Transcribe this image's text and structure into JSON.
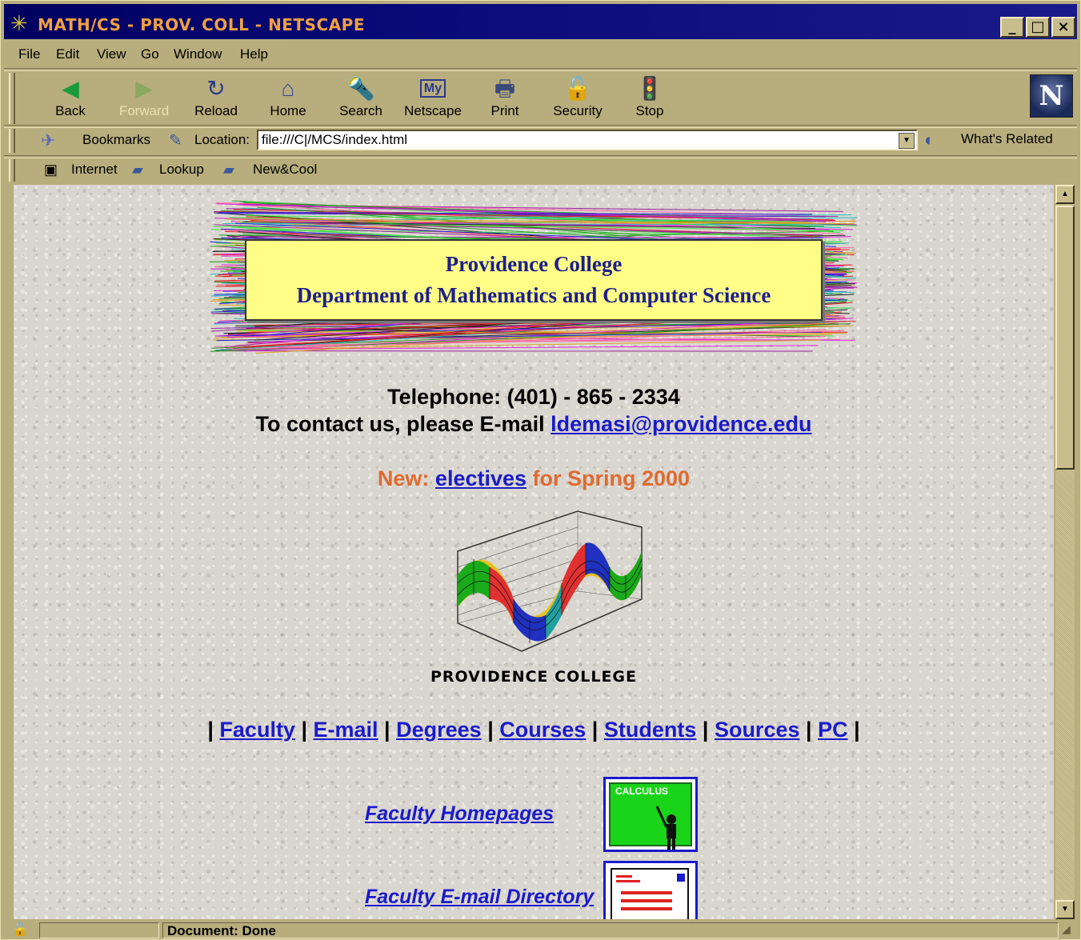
{
  "window": {
    "title": "MATH/CS - PROV. COLL - NETSCAPE",
    "minimize": "_",
    "maximize": "□",
    "close": "×"
  },
  "menu": [
    "File",
    "Edit",
    "View",
    "Go",
    "Window",
    "Help"
  ],
  "nav_toolbar": {
    "back": "Back",
    "forward": "Forward",
    "reload": "Reload",
    "home": "Home",
    "search": "Search",
    "netscape": "Netscape",
    "print": "Print",
    "security": "Security",
    "stop": "Stop",
    "logo": "N"
  },
  "location_bar": {
    "bookmarks": "Bookmarks",
    "location_label": "Location:",
    "url": "file:///C|/MCS/index.html",
    "whats_related": "What's Related"
  },
  "personal_toolbar": [
    "Internet",
    "Lookup",
    "New&Cool"
  ],
  "page": {
    "banner_line1": "Providence College",
    "banner_line2": "Department of Mathematics and Computer Science",
    "telephone": "Telephone: (401) - 865 - 2334",
    "contact_prefix": "To contact us, please E-mail ",
    "contact_email": "ldemasi@providence.edu",
    "new_prefix": "New: ",
    "new_link": "electives",
    "new_suffix": " for Spring 2000",
    "logo_caption": "PROVIDENCE COLLEGE",
    "nav_links": [
      "Faculty",
      "E-mail",
      "Degrees",
      "Courses",
      "Students",
      "Sources",
      "PC"
    ],
    "faculty_homepages": "Faculty Homepages",
    "calc_label": "CALCULUS",
    "faculty_email_directory": "Faculty E-mail Directory"
  },
  "status": {
    "text": "Document: Done"
  },
  "colors": {
    "title_text": "#f0a040",
    "link": "#1a1acc",
    "banner_text": "#1e1e8c",
    "banner_bg": "#ffff88",
    "new_text": "#e06a30",
    "chrome": "#b8ad7d"
  }
}
